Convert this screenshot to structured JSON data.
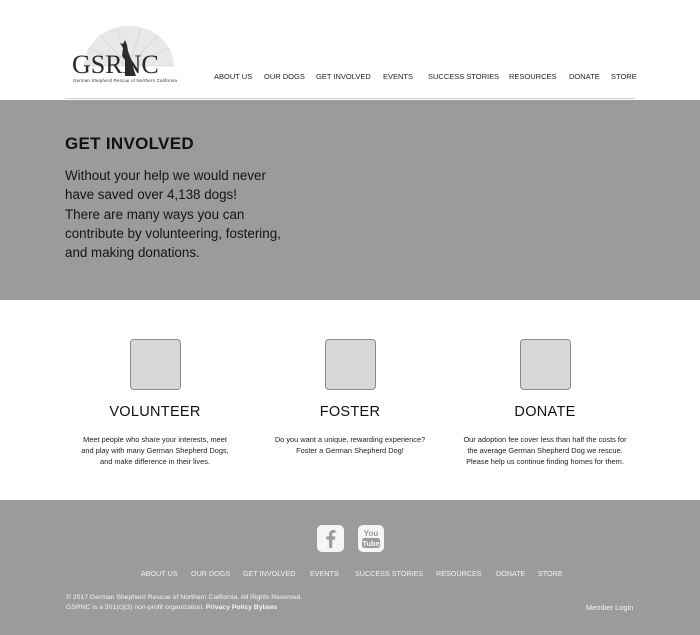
{
  "logo": {
    "text": "GSRNC",
    "subtitle": "German Shepherd Rescue of Northern California"
  },
  "nav": {
    "items": [
      "ABOUT US",
      "OUR DOGS",
      "GET INVOLVED",
      "EVENTS",
      "SUCCESS STORIES",
      "RESOURCES",
      "DONATE",
      "STORE"
    ]
  },
  "hero": {
    "title": "GET INVOLVED",
    "line1": "Without your help we would never",
    "line2": "have saved over 4,138 dogs!",
    "line3": "There are many ways you can",
    "line4": "contribute by volunteering, fostering,",
    "line5": "and making donations."
  },
  "features": [
    {
      "title": "VOLUNTEER",
      "desc1": "Meet people who share your interests, meet",
      "desc2": "and play with many German Shepherd Dogs,",
      "desc3": "and make difference in their lives."
    },
    {
      "title": "FOSTER",
      "desc1": "Do you want a unique, rewarding experience?",
      "desc2": "Foster a German Shepherd Dog!",
      "desc3": ""
    },
    {
      "title": "DONATE",
      "desc1": "Our adoption fee cover less than half the costs for",
      "desc2": "the average German Shepherd Dog we rescue.",
      "desc3": "Please help us continue finding homes for them."
    }
  ],
  "footer": {
    "social": {
      "facebook_icon": "facebook-icon",
      "youtube_icon": "youtube-icon",
      "youtube_top": "You",
      "youtube_bottom": "Tube"
    },
    "nav": [
      "ABOUT US",
      "OUR DOGS",
      "GET INVOLVED",
      "EVENTS",
      "SUCCESS STORIES",
      "RESOURCES",
      "DONATE",
      "STORE"
    ],
    "copyright": "©  2017 German Shepherd Rescue of Northern California. All Rights Reserved.",
    "nonprofit": "GSRNC is a 501(c)(3) non-profit organization.",
    "privacy": "Privacy Policy",
    "bylaws": "Bylaws",
    "member_login": "Member Login"
  },
  "colors": {
    "hero_bg": "#9b9b9b",
    "footer_bg": "#9b9b9b",
    "placeholder_icon": "#d8d8d8"
  }
}
